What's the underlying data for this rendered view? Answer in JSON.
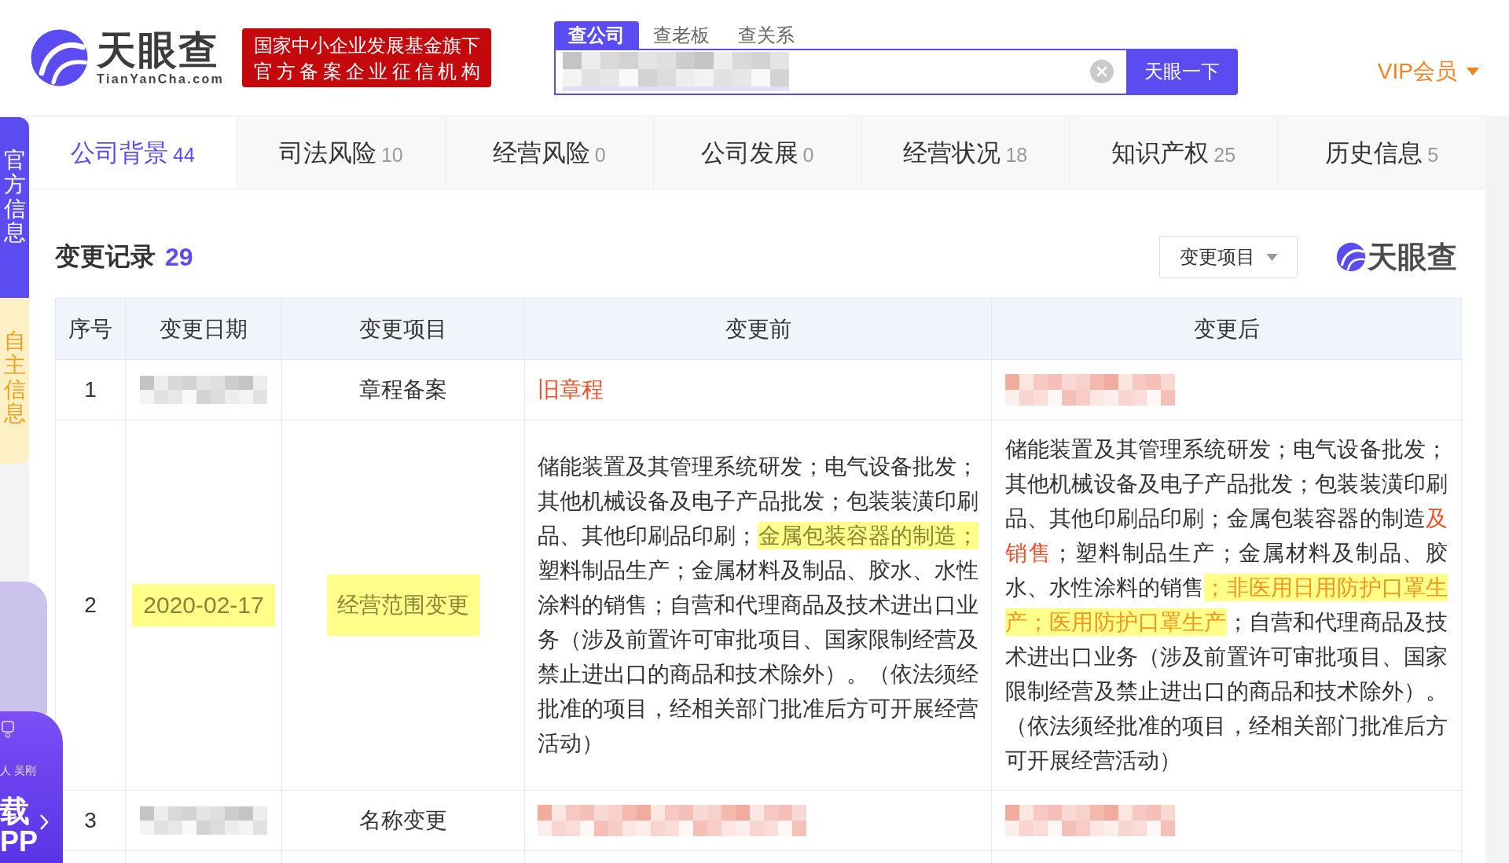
{
  "header": {
    "logo": {
      "name": "天眼查",
      "domain": "TianYanCha.com"
    },
    "slogan": [
      "国家中小企业发展基金旗下",
      "官方备案企业征信机构"
    ],
    "search": {
      "tabs": [
        {
          "label": "查公司",
          "selected": true
        },
        {
          "label": "查老板",
          "selected": false
        },
        {
          "label": "查关系",
          "selected": false
        }
      ],
      "value_redacted": true,
      "button": "天眼一下"
    },
    "vip": {
      "label": "VIP会员"
    }
  },
  "side_tabs": [
    {
      "label": "官方信息",
      "selected": true
    },
    {
      "label": "自主信息",
      "selected": false
    }
  ],
  "promo": {
    "caption": "人 吴刚",
    "lines": [
      "载",
      "PP"
    ]
  },
  "tabs": [
    {
      "label": "公司背景",
      "count": "44",
      "selected": true
    },
    {
      "label": "司法风险",
      "count": "10",
      "selected": false
    },
    {
      "label": "经营风险",
      "count": "0",
      "selected": false
    },
    {
      "label": "公司发展",
      "count": "0",
      "selected": false
    },
    {
      "label": "经营状况",
      "count": "18",
      "selected": false
    },
    {
      "label": "知识产权",
      "count": "25",
      "selected": false
    },
    {
      "label": "历史信息",
      "count": "5",
      "selected": false
    }
  ],
  "section": {
    "title": "变更记录",
    "count": "29",
    "filter": {
      "label": "变更项目"
    },
    "brand": "天眼查"
  },
  "table": {
    "columns": [
      "序号",
      "变更日期",
      "变更项目",
      "变更前",
      "变更后"
    ],
    "rows": [
      {
        "number": "1",
        "date": {
          "kind": "redacted",
          "color": "#c4c4c4"
        },
        "item": {
          "kind": "text",
          "text": "章程备案",
          "highlighted": false
        },
        "before": {
          "kind": "segments",
          "segments": [
            {
              "text": "旧章程",
              "kind": "changed"
            }
          ]
        },
        "after": {
          "kind": "redacted",
          "color": "#f2ab9f"
        }
      },
      {
        "number": "2",
        "date": {
          "kind": "text",
          "text": "2020-02-17",
          "highlighted": true
        },
        "item": {
          "kind": "text",
          "text": "经营范围变更",
          "highlighted": true
        },
        "before": {
          "kind": "segments",
          "segments": [
            {
              "text": "储能装置及其管理系统研发；电气设备批发；其他机械设备及电子产品批发；包装装潢印刷品、其他印刷品印刷；",
              "kind": "plain"
            },
            {
              "text": "金属包装容器的制造；",
              "kind": "marked"
            },
            {
              "text": "塑料制品生产；金属材料及制品、胶水、水性涂料的销售；自营和代理商品及技术进出口业务（涉及前置许可审批项目、国家限制经营及禁止进出口的商品和技术除外）。（依法须经批准的项目，经相关部门批准后方可开展经营活动）",
              "kind": "plain"
            }
          ]
        },
        "after": {
          "kind": "segments",
          "segments": [
            {
              "text": "储能装置及其管理系统研发；电气设备批发；其他机械设备及电子产品批发；包装装潢印刷品、其他印刷品印刷；金属包装容器的制造",
              "kind": "plain"
            },
            {
              "text": "及销售",
              "kind": "changed"
            },
            {
              "text": "；塑料制品生产；金属材料及制品、胶水、水性涂料的销售",
              "kind": "plain"
            },
            {
              "text": "；非医用日用防护口罩生产；医用防护口罩生产",
              "kind": "added"
            },
            {
              "text": "；自营和代理商品及技术进出口业务（涉及前置许可审批项目、国家限制经营及禁止进出口的商品和技术除外）。（依法须经批准的项目，经相关部门批准后方可开展经营活动）",
              "kind": "plain"
            }
          ]
        }
      },
      {
        "number": "3",
        "date": {
          "kind": "redacted",
          "color": "#c4c4c4"
        },
        "item": {
          "kind": "text",
          "text": "名称变更",
          "highlighted": false
        },
        "before": {
          "kind": "redacted",
          "color": "#f2ab9f"
        },
        "after": {
          "kind": "redacted",
          "color": "#f2ab9f"
        }
      }
    ]
  }
}
